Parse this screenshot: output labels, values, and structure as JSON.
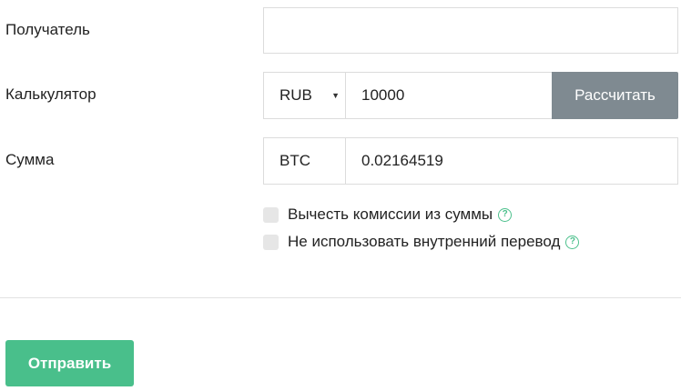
{
  "form": {
    "recipient": {
      "label": "Получатель",
      "value": ""
    },
    "calculator": {
      "label": "Калькулятор",
      "currency": "RUB",
      "amount": "10000",
      "calculate_button": "Рассчитать"
    },
    "sum": {
      "label": "Сумма",
      "currency": "BTC",
      "value": "0.02164519"
    },
    "options": [
      {
        "label": "Вычесть комиссии из суммы",
        "checked": false,
        "icon": "help-icon"
      },
      {
        "label": "Не использовать внутренний перевод",
        "checked": false,
        "icon": "help-icon"
      }
    ],
    "submit_button": "Отправить"
  },
  "colors": {
    "accent": "#49bf8b",
    "calc_button": "#7f8a91",
    "border": "#dcdcdc"
  }
}
